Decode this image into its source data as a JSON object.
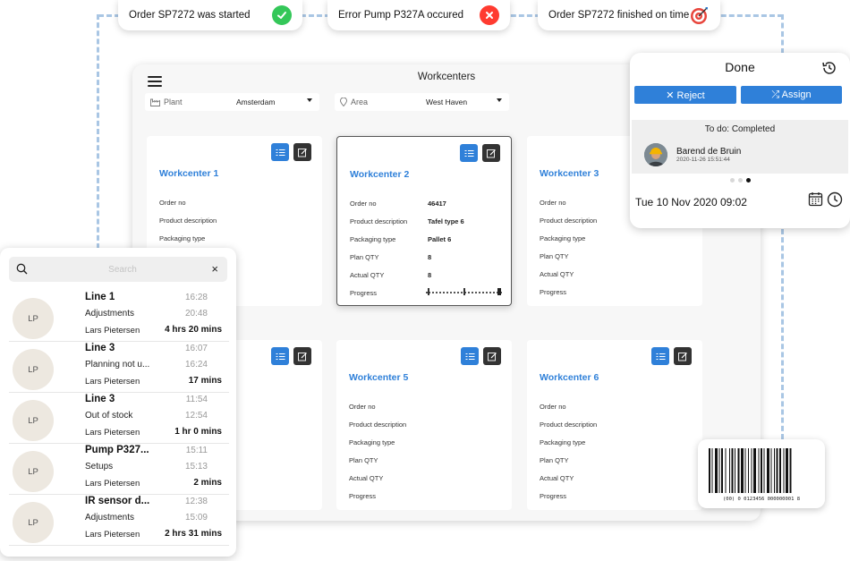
{
  "notifications": [
    {
      "text": "Order SP7272 was started",
      "status": "success",
      "icon": "check-icon"
    },
    {
      "text": "Error Pump P327A occured",
      "status": "error",
      "icon": "x-icon"
    },
    {
      "text": "Order SP7272 finished on time",
      "status": "target",
      "icon": "target-icon"
    }
  ],
  "window": {
    "title": "Workcenters",
    "plant_label": "Plant",
    "plant_value": "Amsterdam",
    "area_label": "Area",
    "area_value": "West Haven"
  },
  "workcenters": [
    {
      "title": "Workcenter 1",
      "rows": [
        "Order no",
        "Product description",
        "Packaging type"
      ]
    },
    {
      "title": "Workcenter 2",
      "rows": [
        "Order no",
        "Product description",
        "Packaging type",
        "Plan QTY",
        "Actual QTY",
        "Progress"
      ],
      "values": [
        "46417",
        "Tafel type 6",
        "Pallet 6",
        "8",
        "8"
      ]
    },
    {
      "title": "Workcenter 3",
      "rows": [
        "Order no",
        "Product description",
        "Packaging type",
        "Plan QTY",
        "Actual QTY",
        "Progress"
      ]
    },
    {
      "title": "",
      "rows": []
    },
    {
      "title": "Workcenter 5",
      "rows": [
        "Order no",
        "Product description",
        "Packaging type",
        "Plan QTY",
        "Actual QTY",
        "Progress"
      ]
    },
    {
      "title": "Workcenter 6",
      "rows": [
        "Order no",
        "Product description",
        "Packaging type",
        "Plan QTY",
        "Actual QTY",
        "Progress"
      ]
    }
  ],
  "done_panel": {
    "title": "Done",
    "reject_label": "✕ Reject",
    "assign_label": "⤮ Assign",
    "todo_label": "To do: Completed",
    "worker_name": "Barend de Bruin",
    "worker_date": "2020-11-26 15:51:44",
    "date": "Tue 10 Nov 2020 09:02"
  },
  "search": {
    "placeholder": "Search",
    "close": "×"
  },
  "events": [
    {
      "initials": "LP",
      "line": "Line 1",
      "reason": "Adjustments",
      "person": "Lars Pietersen",
      "start": "16:28",
      "end": "20:48",
      "duration": "4 hrs 20 mins"
    },
    {
      "initials": "LP",
      "line": "Line 3",
      "reason": "Planning not u...",
      "person": "Lars Pietersen",
      "start": "16:07",
      "end": "16:24",
      "duration": "17 mins"
    },
    {
      "initials": "LP",
      "line": "Line 3",
      "reason": "Out of stock",
      "person": "Lars Pietersen",
      "start": "11:54",
      "end": "12:54",
      "duration": "1 hr 0 mins"
    },
    {
      "initials": "LP",
      "line": "Pump P327...",
      "reason": "Setups",
      "person": "Lars Pietersen",
      "start": "15:11",
      "end": "15:13",
      "duration": "2 mins"
    },
    {
      "initials": "LP",
      "line": "IR sensor d...",
      "reason": "Adjustments",
      "person": "Lars Pietersen",
      "start": "12:38",
      "end": "15:09",
      "duration": "2 hrs 31 mins"
    }
  ],
  "barcode": {
    "number": "(00) 0 0123456 000000001 8"
  },
  "colors": {
    "accent": "#2f80d9",
    "success": "#34c759",
    "error": "#ff3b30",
    "flow_line": "#a9c6e4"
  }
}
